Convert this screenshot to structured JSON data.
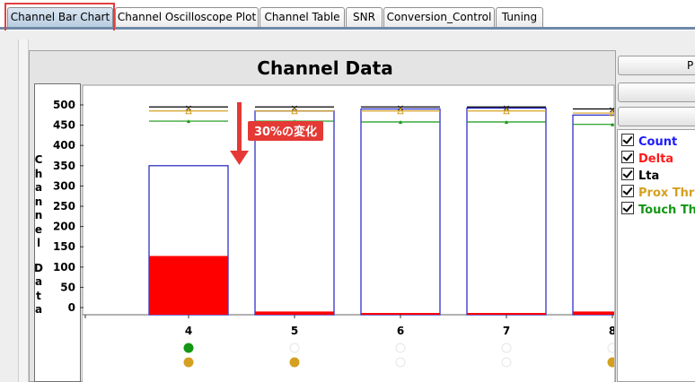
{
  "tabs": [
    {
      "label": "Channel Bar Chart",
      "active": true
    },
    {
      "label": "Channel Oscilloscope Plot",
      "active": false
    },
    {
      "label": "Channel Table",
      "active": false
    },
    {
      "label": "SNR",
      "active": false
    },
    {
      "label": "Conversion_Control",
      "active": false
    },
    {
      "label": "Tuning",
      "active": false
    }
  ],
  "side_buttons": [
    {
      "label": "P"
    },
    {
      "label": ""
    },
    {
      "label": ""
    }
  ],
  "legend": [
    {
      "label": "Count",
      "color": "#1a1aff",
      "checked": true
    },
    {
      "label": "Delta",
      "color": "#ff1a1a",
      "checked": true
    },
    {
      "label": "Lta",
      "color": "#000000",
      "checked": true
    },
    {
      "label": "Prox Thre",
      "color": "#d4a020",
      "checked": true
    },
    {
      "label": "Touch Th",
      "color": "#149614",
      "checked": true
    }
  ],
  "colors": {
    "count": "#2020c0",
    "delta": "#ff0000",
    "lta": "#000000",
    "prox": "#d4a020",
    "touch": "#159615",
    "annotation": "#e53935",
    "tab_highlight": "#e04040"
  },
  "chart_data": {
    "type": "bar",
    "title": "Channel Data",
    "ylabel": "Channel Data",
    "yticks": [
      0,
      50,
      100,
      150,
      200,
      250,
      300,
      350,
      400,
      450,
      500
    ],
    "ylim": [
      0,
      520
    ],
    "categories": [
      "4",
      "5",
      "6",
      "7",
      "8"
    ],
    "series": [
      {
        "name": "Count",
        "values": [
          350,
          485,
          490,
          492,
          475
        ]
      },
      {
        "name": "Delta",
        "values": [
          145,
          8,
          2,
          0,
          8
        ]
      },
      {
        "name": "Lta",
        "values": [
          495,
          495,
          495,
          495,
          490
        ]
      },
      {
        "name": "Prox Thre",
        "values": [
          485,
          485,
          485,
          485,
          480
        ]
      },
      {
        "name": "Touch Th",
        "values": [
          460,
          460,
          458,
          458,
          452
        ]
      }
    ],
    "status_top": [
      "green",
      "white",
      "white",
      "white",
      "white"
    ],
    "status_bottom": [
      "gold",
      "gold",
      "white",
      "white",
      "gold"
    ],
    "annotation": "30%の変化"
  }
}
